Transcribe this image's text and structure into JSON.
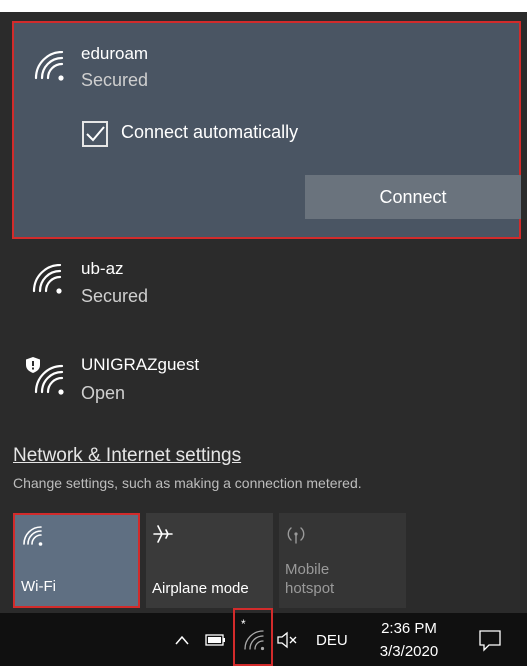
{
  "networks": [
    {
      "name": "eduroam",
      "status": "Secured"
    },
    {
      "name": "ub-az",
      "status": "Secured"
    },
    {
      "name": "UNIGRAZguest",
      "status": "Open"
    }
  ],
  "selected": {
    "connect_auto_label": "Connect automatically",
    "connect_auto_checked": true,
    "connect_button": "Connect"
  },
  "settings": {
    "link": "Network & Internet settings",
    "description": "Change settings, such as making a connection metered."
  },
  "quick_actions": [
    {
      "label": "Wi-Fi",
      "icon": "wifi-icon",
      "active": true
    },
    {
      "label": "Airplane mode",
      "icon": "airplane-icon",
      "active": false
    },
    {
      "label": "Mobile\nhotspot",
      "icon": "hotspot-icon",
      "active": false
    }
  ],
  "taskbar": {
    "language": "DEU",
    "time": "2:36 PM",
    "date": "3/3/2020",
    "icons": [
      "chevron-up-icon",
      "battery-icon",
      "wifi-icon",
      "speaker-muted-icon",
      "action-center-icon"
    ]
  },
  "colors": {
    "flyout_bg": "#2b2b2b",
    "selected_bg": "#4a5563",
    "highlight_border": "#d22b2b",
    "active_tile": "#5f6f82"
  }
}
